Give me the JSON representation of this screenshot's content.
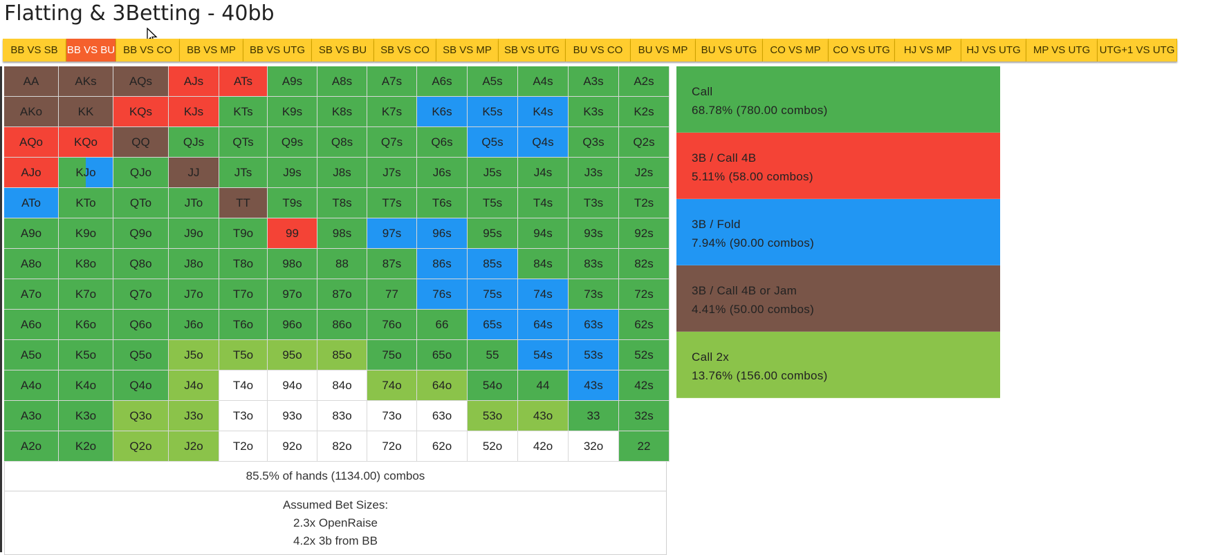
{
  "title": "Flatting & 3Betting - 40bb",
  "tabs": [
    {
      "label": "BB VS SB",
      "active": false,
      "w": 92
    },
    {
      "label": "BB VS BU",
      "active": true,
      "w": 72
    },
    {
      "label": "BB VS CO",
      "active": false,
      "w": 92
    },
    {
      "label": "BB VS MP",
      "active": false,
      "w": 92
    },
    {
      "label": "BB VS UTG",
      "active": false,
      "w": 99
    },
    {
      "label": "SB VS BU",
      "active": false,
      "w": 90
    },
    {
      "label": "SB VS CO",
      "active": false,
      "w": 90
    },
    {
      "label": "SB VS MP",
      "active": false,
      "w": 90
    },
    {
      "label": "SB VS UTG",
      "active": false,
      "w": 97
    },
    {
      "label": "BU VS CO",
      "active": false,
      "w": 94
    },
    {
      "label": "BU VS MP",
      "active": false,
      "w": 94
    },
    {
      "label": "BU VS UTG",
      "active": false,
      "w": 97
    },
    {
      "label": "CO VS MP",
      "active": false,
      "w": 95
    },
    {
      "label": "CO VS UTG",
      "active": false,
      "w": 96
    },
    {
      "label": "HJ VS MP",
      "active": false,
      "w": 96
    },
    {
      "label": "HJ VS UTG",
      "active": false,
      "w": 94
    },
    {
      "label": "MP VS UTG",
      "active": false,
      "w": 103
    },
    {
      "label": "UTG+1 VS UTG",
      "active": false,
      "w": 115
    }
  ],
  "colors": {
    "call": "#4caf50",
    "threebet_call4b": "#f44336",
    "threebet_fold": "#2196f3",
    "threebet_call4b_jam": "#795548",
    "call2x": "#8bc34a",
    "fold": "#ffffff",
    "tab_bg": "#ffcd2e",
    "tab_active": "#f5602c"
  },
  "grid": [
    [
      [
        "AA",
        "3bj"
      ],
      [
        "AKs",
        "3bj"
      ],
      [
        "AQs",
        "3bj"
      ],
      [
        "AJs",
        "3b4b"
      ],
      [
        "ATs",
        "3b4b"
      ],
      [
        "A9s",
        "call"
      ],
      [
        "A8s",
        "call"
      ],
      [
        "A7s",
        "call"
      ],
      [
        "A6s",
        "call"
      ],
      [
        "A5s",
        "call"
      ],
      [
        "A4s",
        "call"
      ],
      [
        "A3s",
        "call"
      ],
      [
        "A2s",
        "call"
      ]
    ],
    [
      [
        "AKo",
        "3bj"
      ],
      [
        "KK",
        "3bj"
      ],
      [
        "KQs",
        "3b4b"
      ],
      [
        "KJs",
        "3b4b"
      ],
      [
        "KTs",
        "call"
      ],
      [
        "K9s",
        "call"
      ],
      [
        "K8s",
        "call"
      ],
      [
        "K7s",
        "call"
      ],
      [
        "K6s",
        "3bf"
      ],
      [
        "K5s",
        "3bf"
      ],
      [
        "K4s",
        "3bf"
      ],
      [
        "K3s",
        "call"
      ],
      [
        "K2s",
        "call"
      ]
    ],
    [
      [
        "AQo",
        "3b4b"
      ],
      [
        "KQo",
        "3b4b"
      ],
      [
        "QQ",
        "3bj"
      ],
      [
        "QJs",
        "call"
      ],
      [
        "QTs",
        "call"
      ],
      [
        "Q9s",
        "call"
      ],
      [
        "Q8s",
        "call"
      ],
      [
        "Q7s",
        "call"
      ],
      [
        "Q6s",
        "call"
      ],
      [
        "Q5s",
        "3bf"
      ],
      [
        "Q4s",
        "3bf"
      ],
      [
        "Q3s",
        "call"
      ],
      [
        "Q2s",
        "call"
      ]
    ],
    [
      [
        "AJo",
        "3b4b"
      ],
      [
        "KJo",
        "split"
      ],
      [
        "QJo",
        "call"
      ],
      [
        "JJ",
        "3bj"
      ],
      [
        "JTs",
        "call"
      ],
      [
        "J9s",
        "call"
      ],
      [
        "J8s",
        "call"
      ],
      [
        "J7s",
        "call"
      ],
      [
        "J6s",
        "call"
      ],
      [
        "J5s",
        "call"
      ],
      [
        "J4s",
        "call"
      ],
      [
        "J3s",
        "call"
      ],
      [
        "J2s",
        "call"
      ]
    ],
    [
      [
        "ATo",
        "3bf"
      ],
      [
        "KTo",
        "call"
      ],
      [
        "QTo",
        "call"
      ],
      [
        "JTo",
        "call"
      ],
      [
        "TT",
        "3bj"
      ],
      [
        "T9s",
        "call"
      ],
      [
        "T8s",
        "call"
      ],
      [
        "T7s",
        "call"
      ],
      [
        "T6s",
        "call"
      ],
      [
        "T5s",
        "call"
      ],
      [
        "T4s",
        "call"
      ],
      [
        "T3s",
        "call"
      ],
      [
        "T2s",
        "call"
      ]
    ],
    [
      [
        "A9o",
        "call"
      ],
      [
        "K9o",
        "call"
      ],
      [
        "Q9o",
        "call"
      ],
      [
        "J9o",
        "call"
      ],
      [
        "T9o",
        "call"
      ],
      [
        "99",
        "3b4b"
      ],
      [
        "98s",
        "call"
      ],
      [
        "97s",
        "3bf"
      ],
      [
        "96s",
        "3bf"
      ],
      [
        "95s",
        "call"
      ],
      [
        "94s",
        "call"
      ],
      [
        "93s",
        "call"
      ],
      [
        "92s",
        "call"
      ]
    ],
    [
      [
        "A8o",
        "call"
      ],
      [
        "K8o",
        "call"
      ],
      [
        "Q8o",
        "call"
      ],
      [
        "J8o",
        "call"
      ],
      [
        "T8o",
        "call"
      ],
      [
        "98o",
        "call"
      ],
      [
        "88",
        "call"
      ],
      [
        "87s",
        "call"
      ],
      [
        "86s",
        "3bf"
      ],
      [
        "85s",
        "3bf"
      ],
      [
        "84s",
        "call"
      ],
      [
        "83s",
        "call"
      ],
      [
        "82s",
        "call"
      ]
    ],
    [
      [
        "A7o",
        "call"
      ],
      [
        "K7o",
        "call"
      ],
      [
        "Q7o",
        "call"
      ],
      [
        "J7o",
        "call"
      ],
      [
        "T7o",
        "call"
      ],
      [
        "97o",
        "call"
      ],
      [
        "87o",
        "call"
      ],
      [
        "77",
        "call"
      ],
      [
        "76s",
        "3bf"
      ],
      [
        "75s",
        "3bf"
      ],
      [
        "74s",
        "3bf"
      ],
      [
        "73s",
        "call"
      ],
      [
        "72s",
        "call"
      ]
    ],
    [
      [
        "A6o",
        "call"
      ],
      [
        "K6o",
        "call"
      ],
      [
        "Q6o",
        "call"
      ],
      [
        "J6o",
        "call"
      ],
      [
        "T6o",
        "call"
      ],
      [
        "96o",
        "call"
      ],
      [
        "86o",
        "call"
      ],
      [
        "76o",
        "call"
      ],
      [
        "66",
        "call"
      ],
      [
        "65s",
        "3bf"
      ],
      [
        "64s",
        "3bf"
      ],
      [
        "63s",
        "3bf"
      ],
      [
        "62s",
        "call"
      ]
    ],
    [
      [
        "A5o",
        "call"
      ],
      [
        "K5o",
        "call"
      ],
      [
        "Q5o",
        "call"
      ],
      [
        "J5o",
        "c2x"
      ],
      [
        "T5o",
        "c2x"
      ],
      [
        "95o",
        "c2x"
      ],
      [
        "85o",
        "c2x"
      ],
      [
        "75o",
        "call"
      ],
      [
        "65o",
        "call"
      ],
      [
        "55",
        "call"
      ],
      [
        "54s",
        "3bf"
      ],
      [
        "53s",
        "3bf"
      ],
      [
        "52s",
        "call"
      ]
    ],
    [
      [
        "A4o",
        "call"
      ],
      [
        "K4o",
        "call"
      ],
      [
        "Q4o",
        "call"
      ],
      [
        "J4o",
        "c2x"
      ],
      [
        "T4o",
        "fold"
      ],
      [
        "94o",
        "fold"
      ],
      [
        "84o",
        "fold"
      ],
      [
        "74o",
        "c2x"
      ],
      [
        "64o",
        "c2x"
      ],
      [
        "54o",
        "call"
      ],
      [
        "44",
        "call"
      ],
      [
        "43s",
        "3bf"
      ],
      [
        "42s",
        "call"
      ]
    ],
    [
      [
        "A3o",
        "call"
      ],
      [
        "K3o",
        "call"
      ],
      [
        "Q3o",
        "c2x"
      ],
      [
        "J3o",
        "c2x"
      ],
      [
        "T3o",
        "fold"
      ],
      [
        "93o",
        "fold"
      ],
      [
        "83o",
        "fold"
      ],
      [
        "73o",
        "fold"
      ],
      [
        "63o",
        "fold"
      ],
      [
        "53o",
        "c2x"
      ],
      [
        "43o",
        "c2x"
      ],
      [
        "33",
        "call"
      ],
      [
        "32s",
        "call"
      ]
    ],
    [
      [
        "A2o",
        "call"
      ],
      [
        "K2o",
        "call"
      ],
      [
        "Q2o",
        "c2x"
      ],
      [
        "J2o",
        "c2x"
      ],
      [
        "T2o",
        "fold"
      ],
      [
        "92o",
        "fold"
      ],
      [
        "82o",
        "fold"
      ],
      [
        "72o",
        "fold"
      ],
      [
        "62o",
        "fold"
      ],
      [
        "52o",
        "fold"
      ],
      [
        "42o",
        "fold"
      ],
      [
        "32o",
        "fold"
      ],
      [
        "22",
        "call"
      ]
    ]
  ],
  "split_cell": {
    "left": "call",
    "right": "3bf",
    "ratio": 0.5
  },
  "summary": "85.5% of hands (1134.00) combos",
  "bet_sizes": {
    "heading": "Assumed Bet Sizes:",
    "line1": "2.3x OpenRaise",
    "line2": "4.2x 3b from BB"
  },
  "legend": [
    {
      "key": "call",
      "label": "Call",
      "stat": "68.78% (780.00 combos)"
    },
    {
      "key": "3b4b",
      "label": "3B / Call 4B",
      "stat": "5.11% (58.00 combos)"
    },
    {
      "key": "3bf",
      "label": "3B / Fold",
      "stat": "7.94% (90.00 combos)"
    },
    {
      "key": "3bj",
      "label": "3B / Call 4B or Jam",
      "stat": "4.41% (50.00 combos)"
    },
    {
      "key": "c2x",
      "label": "Call 2x",
      "stat": "13.76% (156.00 combos)"
    }
  ]
}
